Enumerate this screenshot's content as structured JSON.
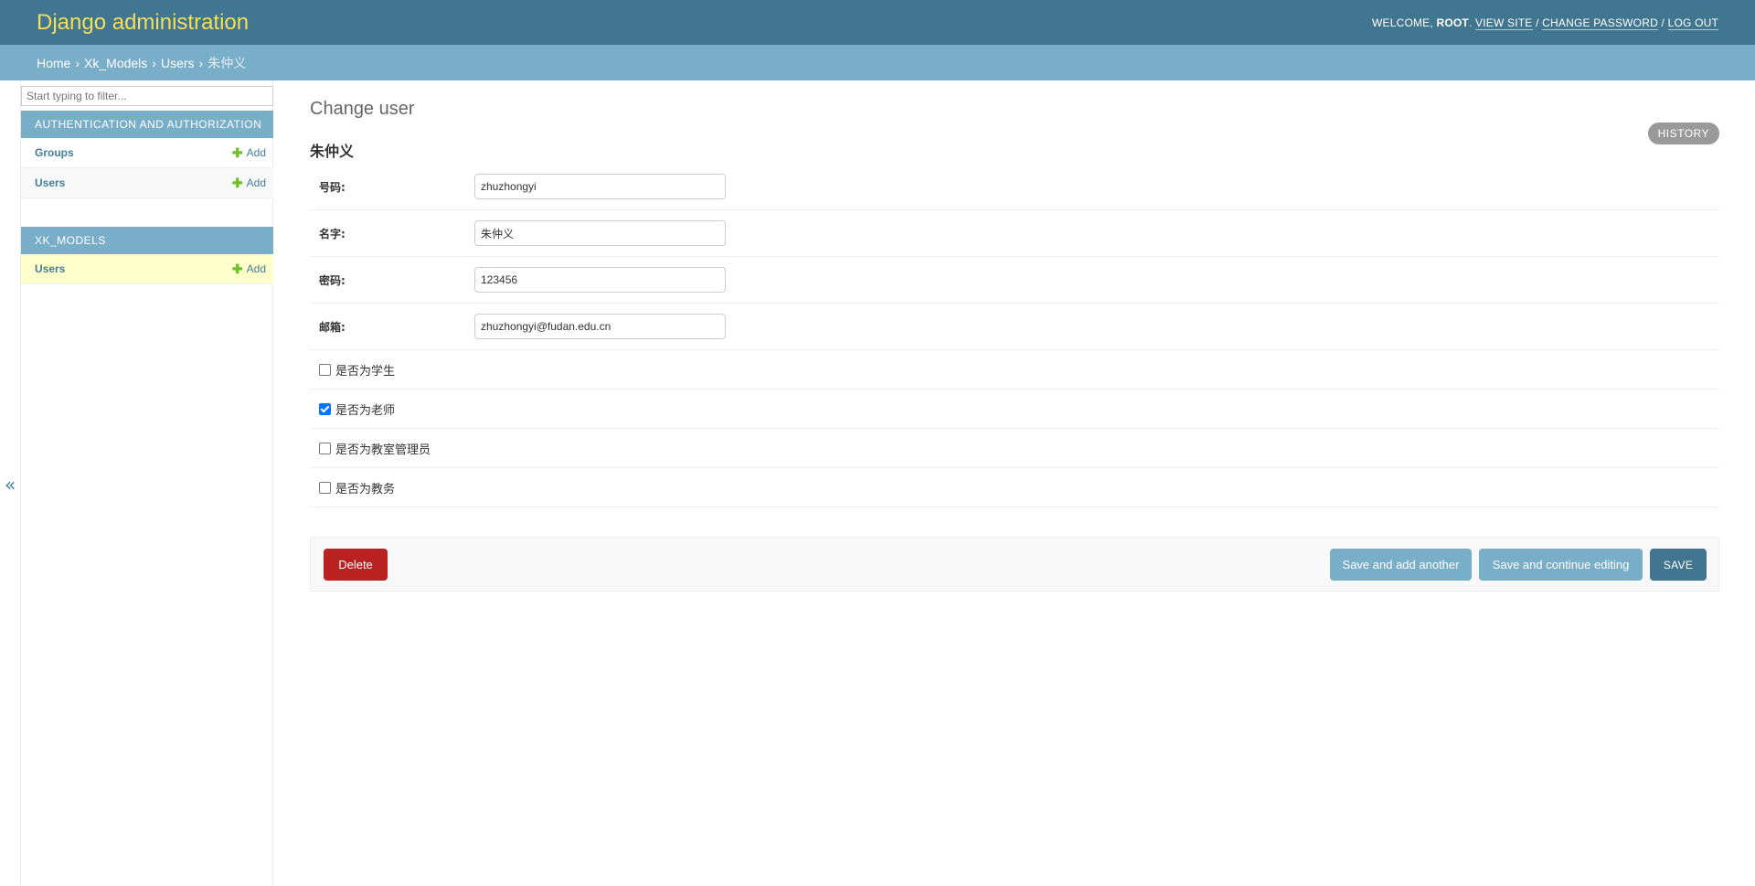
{
  "header": {
    "branding": "Django administration",
    "welcome": "WELCOME,",
    "username": "ROOT",
    "view_site": "VIEW SITE",
    "change_password": "CHANGE PASSWORD",
    "log_out": "LOG OUT",
    "separator": "/"
  },
  "breadcrumbs": {
    "home": "Home",
    "app": "Xk_Models",
    "model": "Users",
    "current": "朱仲义",
    "sep": "›"
  },
  "sidebar": {
    "filter_placeholder": "Start typing to filter...",
    "modules": [
      {
        "caption": "AUTHENTICATION AND AUTHORIZATION",
        "rows": [
          {
            "name": "Groups",
            "add": "Add"
          },
          {
            "name": "Users",
            "add": "Add"
          }
        ]
      },
      {
        "caption": "XK_MODELS",
        "rows": [
          {
            "name": "Users",
            "add": "Add"
          }
        ]
      }
    ],
    "toggle": "«"
  },
  "content": {
    "title": "Change user",
    "object_title": "朱仲义",
    "history": "HISTORY",
    "fields": [
      {
        "label": "号码:",
        "value": "zhuzhongyi"
      },
      {
        "label": "名字:",
        "value": "朱仲义"
      },
      {
        "label": "密码:",
        "value": "123456"
      },
      {
        "label": "邮箱:",
        "value": "zhuzhongyi@fudan.edu.cn"
      }
    ],
    "checkboxes": [
      {
        "label": "是否为学生",
        "checked": false
      },
      {
        "label": "是否为老师",
        "checked": true
      },
      {
        "label": "是否为教室管理员",
        "checked": false
      },
      {
        "label": "是否为教务",
        "checked": false
      }
    ],
    "buttons": {
      "delete": "Delete",
      "save_add_another": "Save and add another",
      "save_continue": "Save and continue editing",
      "save": "SAVE"
    }
  },
  "colors": {
    "header_bg": "#417690",
    "branding": "#f5dd5d",
    "breadcrumbs_bg": "#79aec8",
    "link": "#447e9b",
    "add_plus": "#70bf2b",
    "delete": "#ba2121",
    "selected_row": "#ffffcc"
  }
}
